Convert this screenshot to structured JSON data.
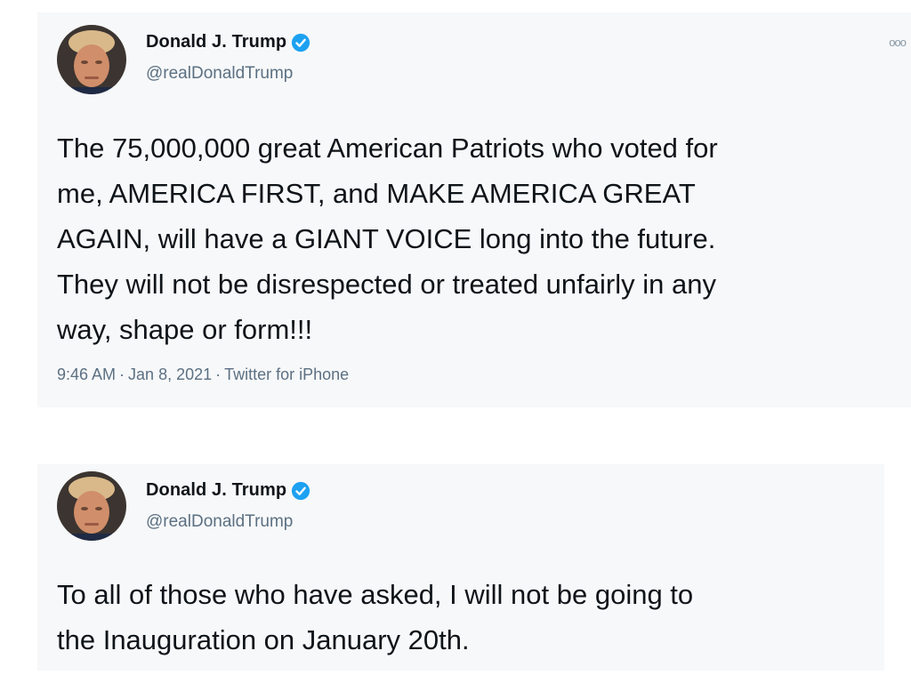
{
  "tweets": [
    {
      "display_name": "Donald J. Trump",
      "handle": "@realDonaldTrump",
      "verified": true,
      "more_label": "ooo",
      "text": "The 75,000,000 great American Patriots who voted for\nme, AMERICA FIRST, and MAKE AMERICA GREAT\nAGAIN, will have a GIANT VOICE long into the future.\nThey will not be disrespected or treated unfairly in any\nway, shape or form!!!",
      "time": "9:46 AM",
      "date": "Jan 8, 2021",
      "source": "Twitter for iPhone",
      "separator": "·"
    },
    {
      "display_name": "Donald J. Trump",
      "handle": "@realDonaldTrump",
      "verified": true,
      "text": "To all of those who have asked, I will not be going to\nthe Inauguration on January 20th."
    }
  ],
  "colors": {
    "verified_badge": "#1da1f2",
    "secondary_text": "#5b7083",
    "primary_text": "#0f1419"
  }
}
